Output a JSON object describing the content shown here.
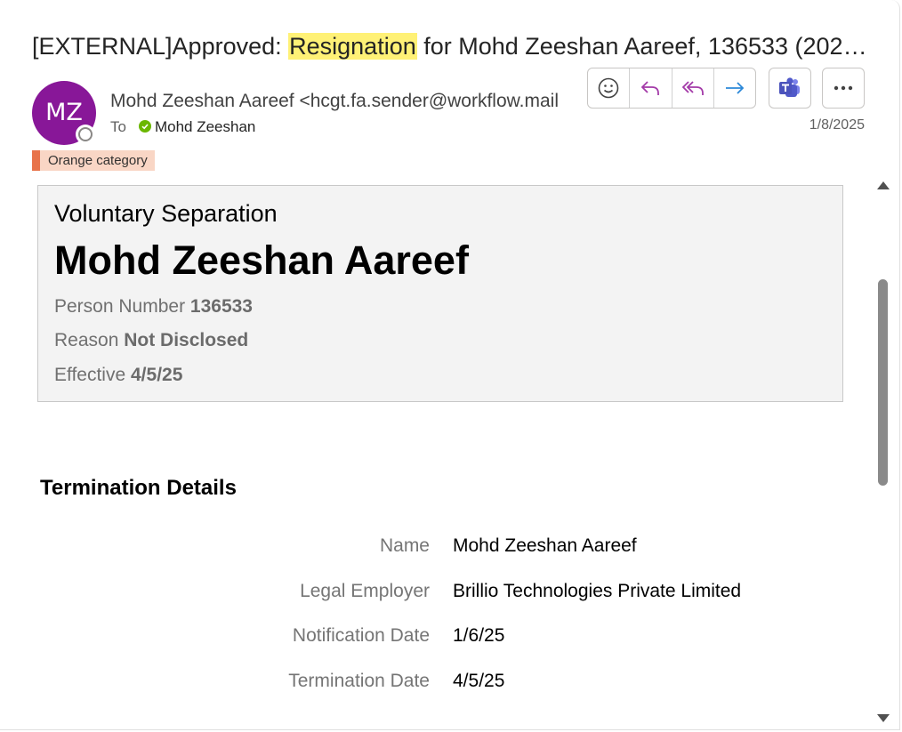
{
  "email": {
    "subject_prefix": "[EXTERNAL]Approved: ",
    "subject_highlight": "Resignation",
    "subject_suffix": " for Mohd Zeeshan Aareef, 136533 (202…",
    "avatar_initials": "MZ",
    "avatar_color": "#881798",
    "sender": "Mohd Zeeshan Aareef <hcgt.fa.sender@workflow.mail.em",
    "to_label": "To",
    "recipient": "Mohd Zeeshan",
    "date": "1/8/2025",
    "category": "Orange category",
    "category_color": "#e8734a"
  },
  "toolbar": {
    "icons": [
      "emoji-icon",
      "reply-icon",
      "reply-all-icon",
      "forward-icon",
      "teams-icon",
      "more-icon"
    ]
  },
  "card": {
    "title": "Voluntary Separation",
    "name": "Mohd Zeeshan Aareef",
    "person_number_label": "Person Number ",
    "person_number": "136533",
    "reason_label": "Reason ",
    "reason": "Not Disclosed",
    "effective_label": "Effective ",
    "effective": "4/5/25"
  },
  "details": {
    "section_title": "Termination Details",
    "rows": [
      {
        "label": "Name",
        "value": "Mohd Zeeshan Aareef"
      },
      {
        "label": "Legal Employer",
        "value": "Brillio Technologies Private Limited"
      },
      {
        "label": "Notification Date",
        "value": "1/6/25"
      },
      {
        "label": "Termination Date",
        "value": "4/5/25"
      }
    ]
  }
}
